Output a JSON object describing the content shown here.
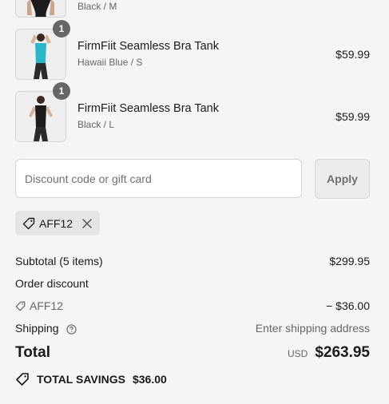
{
  "cart": {
    "items": [
      {
        "variant": "Black / M",
        "quantity": ""
      },
      {
        "name": "FirmFiit Seamless Bra Tank",
        "variant": "Hawaii Blue / S",
        "price": "$59.99",
        "quantity": "1",
        "color": "#2ab6c9"
      },
      {
        "name": "FirmFiit Seamless Bra Tank",
        "variant": "Black / L",
        "price": "$59.99",
        "quantity": "1",
        "color": "#1c1c1c"
      }
    ]
  },
  "discount": {
    "placeholder": "Discount code or gift card",
    "value": "",
    "apply_label": "Apply",
    "applied_code": "AFF12"
  },
  "summary": {
    "subtotal_label": "Subtotal (5 items)",
    "subtotal_value": "$299.95",
    "order_discount_label": "Order discount",
    "discount_code": "AFF12",
    "discount_value": "− $36.00",
    "shipping_label": "Shipping",
    "shipping_value": "Enter shipping address",
    "total_label": "Total",
    "currency": "USD",
    "total_value": "$263.95",
    "savings_label": "TOTAL SAVINGS",
    "savings_value": "$36.00"
  },
  "icons": {
    "tag": "tag-icon",
    "remove": "close-icon",
    "help": "question-circle-icon",
    "savings": "price-tag-icon"
  },
  "colors": {
    "accent": "#1a1a1a",
    "muted": "#666666",
    "background": "#f5f5f5"
  }
}
